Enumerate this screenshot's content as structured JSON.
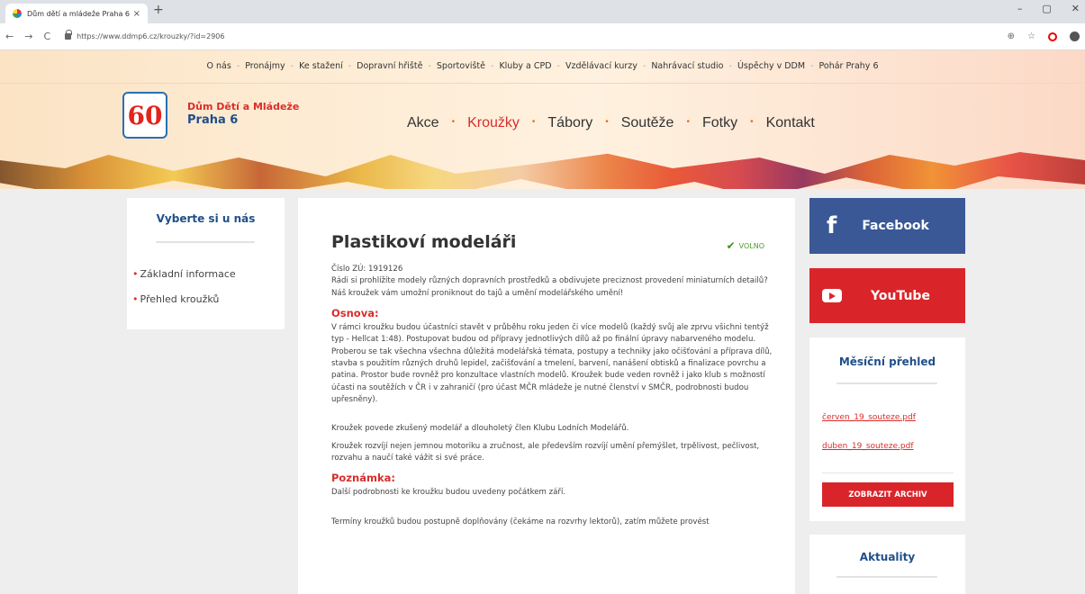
{
  "browser": {
    "tab_title": "Dům dětí a mládeže Praha 6",
    "tab_close": "×",
    "new_tab": "+",
    "url": "https://www.ddmp6.cz/krouzky/?id=2906",
    "nav_back": "←",
    "nav_forward": "→",
    "nav_reload": "C",
    "zoom_icon": "⊕",
    "star_icon": "☆",
    "win_min": "–",
    "win_max": "▢",
    "win_close": "✕"
  },
  "top_menu": [
    "O nás",
    "Pronájmy",
    "Ke stažení",
    "Dopravní hřiště",
    "Sportoviště",
    "Kluby a CPD",
    "Vzdělávací kurzy",
    "Nahrávací studio",
    "Úspěchy v DDM",
    "Pohár Prahy 6"
  ],
  "top_menu_sep": "-",
  "brand": {
    "logo_text": "60",
    "line1": "Dům Dětí a Mládeže",
    "line2": "Praha 6"
  },
  "main_menu": [
    {
      "label": "Akce",
      "active": false
    },
    {
      "label": "Kroužky",
      "active": true
    },
    {
      "label": "Tábory",
      "active": false
    },
    {
      "label": "Soutěže",
      "active": false
    },
    {
      "label": "Fotky",
      "active": false
    },
    {
      "label": "Kontakt",
      "active": false
    }
  ],
  "main_menu_sep": "•",
  "sidebar": {
    "heading": "Vyberte si u nás",
    "bullet": "•",
    "items": [
      "Základní informace",
      "Přehled kroužků"
    ]
  },
  "article": {
    "title": "Plastikoví modeláři",
    "status_icon": "✔",
    "status": "VOLNO",
    "code": "Číslo ZÚ: 1919126",
    "intro": "Rádi si prohlížíte modely různých dopravních prostředků a obdivujete preciznost provedení miniaturních detailů? Náš kroužek vám umožní proniknout do tajů a umění modelářského umění!",
    "osnova_heading": "Osnova:",
    "osnova_text": "V rámci kroužku budou účastníci stavět v průběhu roku jeden či více modelů (každý svůj ale zprvu všichni tentýž typ - Hellcat 1:48). Postupovat budou od přípravy jednotlivých dílů až po finální úpravy nabarveného modelu. Proberou se tak všechna všechna důležitá modelářská témata, postupy a techniky jako očišťování a příprava dílů, stavba s použitím různých druhů lepidel, začišťování a tmelení, barvení, nanášení obtisků a finalizace povrchu a patina. Prostor bude rovněž pro konzultace vlastních modelů. Kroužek bude veden rovněž i jako klub s možností účasti na soutěžích v ČR i v zahraničí (pro účast MČR mládeže je nutné členství v SMČR, podrobnosti budou upřesněny).",
    "lector_text": "Kroužek povede zkušený modelář a dlouholetý člen Klubu Lodních Modelářů.",
    "develop_text": "Kroužek rozvíjí nejen jemnou motoriku a zručnost, ale především rozvíjí umění přemýšlet, trpělivost, pečlivost, rozvahu a naučí také vážit si své práce.",
    "note_heading": "Poznámka:",
    "note_text": "Další podrobnosti ke kroužku budou uvedeny počátkem září.",
    "terms_text": "Termíny kroužků budou postupně doplňovány (čekáme na rozvrhy lektorů), zatím můžete provést"
  },
  "social": {
    "facebook_icon": "f",
    "facebook_label": "Facebook",
    "youtube_label": "YouTube"
  },
  "monthly": {
    "heading": "Měsíční přehled",
    "files": [
      "červen_19_souteze.pdf",
      "duben_19_souteze.pdf"
    ],
    "archive_button": "ZOBRAZIT ARCHIV"
  },
  "news": {
    "heading": "Aktuality"
  },
  "colors": {
    "accent_red": "#d92e2b",
    "brand_blue": "#1f4f8a",
    "facebook": "#3a5896",
    "youtube": "#d9252a",
    "status_green": "#4a9a2c"
  }
}
